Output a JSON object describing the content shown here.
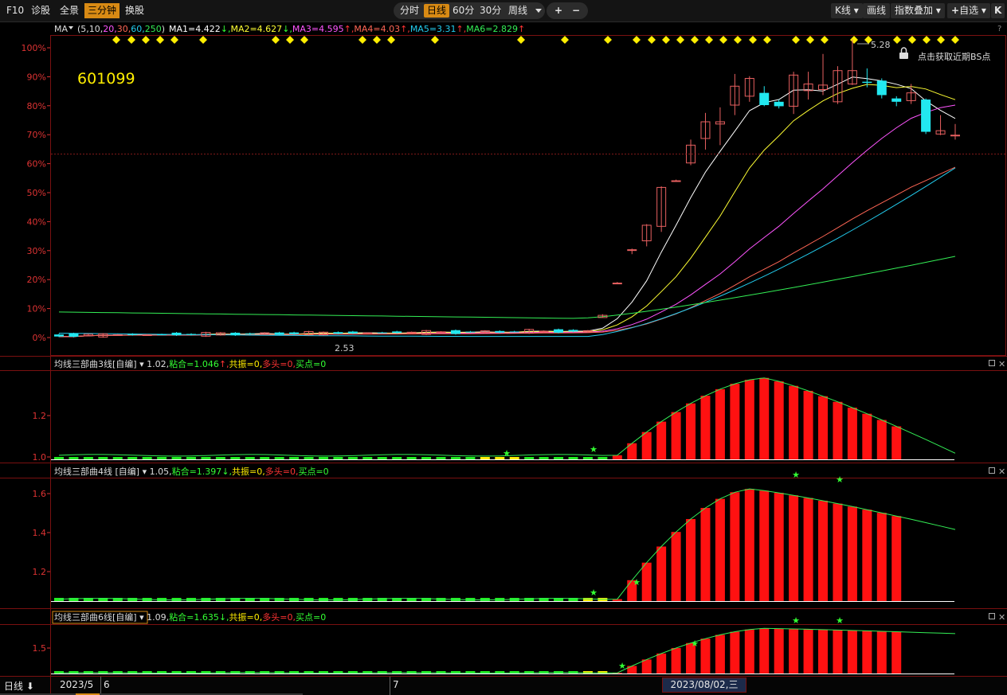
{
  "toolbar": {
    "left": [
      "F10",
      "诊股",
      "全景",
      "三分钟",
      "换股"
    ],
    "left_selected": 3,
    "periods": [
      "分时",
      "日线",
      "60分",
      "30分",
      "周线"
    ],
    "period_selected": 1,
    "zoom_in": "+",
    "zoom_out": "−",
    "right": [
      "K线",
      "画线",
      "指数叠加",
      "自选"
    ],
    "right_close": "K"
  },
  "main_panel": {
    "indicator_name": "MA",
    "params_open": "(",
    "params": [
      "5",
      "10",
      "20",
      "30",
      "60",
      "250"
    ],
    "params_close": ")",
    "ma_values": [
      {
        "label": "MA1=4.422",
        "arrow": "↓",
        "color": "#ffffff"
      },
      {
        "label": "MA2=4.627",
        "arrow": "↓",
        "color": "#ffff33"
      },
      {
        "label": "MA3=4.595",
        "arrow": "↑",
        "color": "#ff55ff"
      },
      {
        "label": "MA4=4.03",
        "arrow": "↑",
        "color": "#ff6655"
      },
      {
        "label": "MA5=3.31",
        "arrow": "↑",
        "color": "#22ccee"
      },
      {
        "label": "MA6=2.829",
        "arrow": "↑",
        "color": "#33ee55"
      }
    ],
    "help": "?",
    "stock_code": "601099",
    "high_label": "5.28",
    "low_label": "2.53",
    "bs_hint": "点击获取近期BS点",
    "y_axis_labels": [
      "100%",
      "90%",
      "80%",
      "70%",
      "60%",
      "50%",
      "40%",
      "30%",
      "20%",
      "10%",
      "0%"
    ]
  },
  "subpanels": [
    {
      "title": "均线三部曲3线[自编]",
      "value": "1.02,",
      "nianhe": "粘合=1.046",
      "nianhe_arrow": "↑",
      "gongzhen": "共振=0,",
      "duotou": "多头=0",
      "maidian": "买点=0",
      "y_labels": [
        "1.2",
        "1.0"
      ],
      "boxed": false
    },
    {
      "title": "均线三部曲4线 [自编]",
      "value": "1.05,",
      "nianhe": "粘合=1.397",
      "nianhe_arrow": "↓",
      "gongzhen": "共振=0,",
      "duotou": "多头=0",
      "maidian": "买点=0",
      "y_labels": [
        "1.6",
        "1.4",
        "1.2"
      ],
      "boxed": false
    },
    {
      "title": "均线三部曲6线[自编]",
      "value": "1.09,",
      "nianhe": "粘合=1.635",
      "nianhe_arrow": "↓",
      "gongzhen": "共振=0,",
      "duotou": "多头=0",
      "maidian": "买点=0",
      "y_labels": [
        "1.5"
      ],
      "boxed": true
    }
  ],
  "bottom": {
    "period": "日线",
    "dates": [
      "2023/5",
      "6",
      "7"
    ],
    "cursor_date": "2023/08/02,三"
  },
  "chart_data": [
    {
      "type": "candlestick",
      "title": "601099",
      "ylabel": "",
      "ylim": [
        2.45,
        5.32
      ],
      "y_axis": "percent",
      "grid": false,
      "price_high": 5.28,
      "price_low": 2.53,
      "current_price": 4.42,
      "series": [
        {
          "name": "MA1",
          "period": 5,
          "color": "#ffffff"
        },
        {
          "name": "MA2",
          "period": 10,
          "color": "#ffff33"
        },
        {
          "name": "MA3",
          "period": 20,
          "color": "#ff55ff"
        },
        {
          "name": "MA4",
          "period": 30,
          "color": "#ff6655"
        },
        {
          "name": "MA5",
          "period": 60,
          "color": "#22ccee"
        },
        {
          "name": "MA6",
          "period": 250,
          "color": "#33ee55"
        }
      ],
      "ma6_start_end": [
        2.83,
        3.32
      ],
      "ma5_start_end": [
        2.64,
        4.13
      ],
      "candles_flat_start_end": [
        2.62,
        2.66
      ],
      "candles_rally": [
        {
          "o": 2.78,
          "c": 2.8,
          "h": 2.81,
          "l": 2.78
        },
        {
          "o": 3.09,
          "c": 3.09,
          "h": 3.1,
          "l": 3.08
        },
        {
          "o": 3.39,
          "c": 3.39,
          "h": 3.4,
          "l": 3.35
        },
        {
          "o": 3.47,
          "c": 3.61,
          "h": 3.62,
          "l": 3.42
        },
        {
          "o": 3.6,
          "c": 3.95,
          "h": 3.96,
          "l": 3.55
        },
        {
          "o": 4.01,
          "c": 4.01,
          "h": 4.02,
          "l": 4.0
        },
        {
          "o": 4.17,
          "c": 4.33,
          "h": 4.38,
          "l": 4.15
        },
        {
          "o": 4.39,
          "c": 4.54,
          "h": 4.62,
          "l": 4.29
        },
        {
          "o": 4.52,
          "c": 4.54,
          "h": 4.67,
          "l": 4.33
        },
        {
          "o": 4.69,
          "c": 4.86,
          "h": 4.97,
          "l": 4.6
        },
        {
          "o": 4.77,
          "c": 4.93,
          "h": 4.95,
          "l": 4.72
        },
        {
          "o": 4.8,
          "c": 4.69,
          "h": 4.86,
          "l": 4.68
        },
        {
          "o": 4.72,
          "c": 4.68,
          "h": 4.74,
          "l": 4.66
        },
        {
          "o": 4.68,
          "c": 4.96,
          "h": 4.99,
          "l": 4.61
        },
        {
          "o": 4.82,
          "c": 4.88,
          "h": 4.99,
          "l": 4.74
        },
        {
          "o": 4.83,
          "c": 4.87,
          "h": 5.15,
          "l": 4.78
        },
        {
          "o": 4.72,
          "c": 5.0,
          "h": 5.04,
          "l": 4.7
        },
        {
          "o": 4.88,
          "c": 5.0,
          "h": 5.28,
          "l": 4.87
        },
        {
          "o": 4.9,
          "c": 4.89,
          "h": 5.02,
          "l": 4.85
        },
        {
          "o": 4.91,
          "c": 4.78,
          "h": 4.93,
          "l": 4.75
        },
        {
          "o": 4.75,
          "c": 4.72,
          "h": 4.77,
          "l": 4.68
        },
        {
          "o": 4.73,
          "c": 4.8,
          "h": 4.88,
          "l": 4.7
        },
        {
          "o": 4.74,
          "c": 4.45,
          "h": 4.75,
          "l": 4.43
        },
        {
          "o": 4.43,
          "c": 4.46,
          "h": 4.6,
          "l": 4.42
        },
        {
          "o": 4.42,
          "c": 4.42,
          "h": 4.52,
          "l": 4.38
        }
      ],
      "markers": "yellow diamonds along top of panel"
    },
    {
      "type": "bar",
      "title": "均线三部曲3线[自编]",
      "ylim": [
        0.99,
        1.42
      ],
      "values_peak": 1.39,
      "values_start": 1.01,
      "values_end": 1.02,
      "line_color": "#33ee55",
      "bar_colors": [
        "#ff1111",
        "#22ee22",
        "#ffee00"
      ]
    },
    {
      "type": "bar",
      "title": "均线三部曲4线 [自编]",
      "ylim": [
        1.03,
        1.66
      ],
      "values_peak": 1.61,
      "values_start": 1.04,
      "values_end": 1.4,
      "line_color": "#33ee55",
      "bar_colors": [
        "#ff1111",
        "#22ee22",
        "#ffee00"
      ]
    },
    {
      "type": "bar",
      "title": "均线三部曲6线[自编]",
      "ylim": [
        1.0,
        1.73
      ],
      "values_peak": 1.69,
      "values_start": 1.01,
      "values_end": 1.61,
      "line_color": "#33ee55",
      "bar_colors": [
        "#ff1111",
        "#22ee22",
        "#ffee00"
      ]
    }
  ]
}
